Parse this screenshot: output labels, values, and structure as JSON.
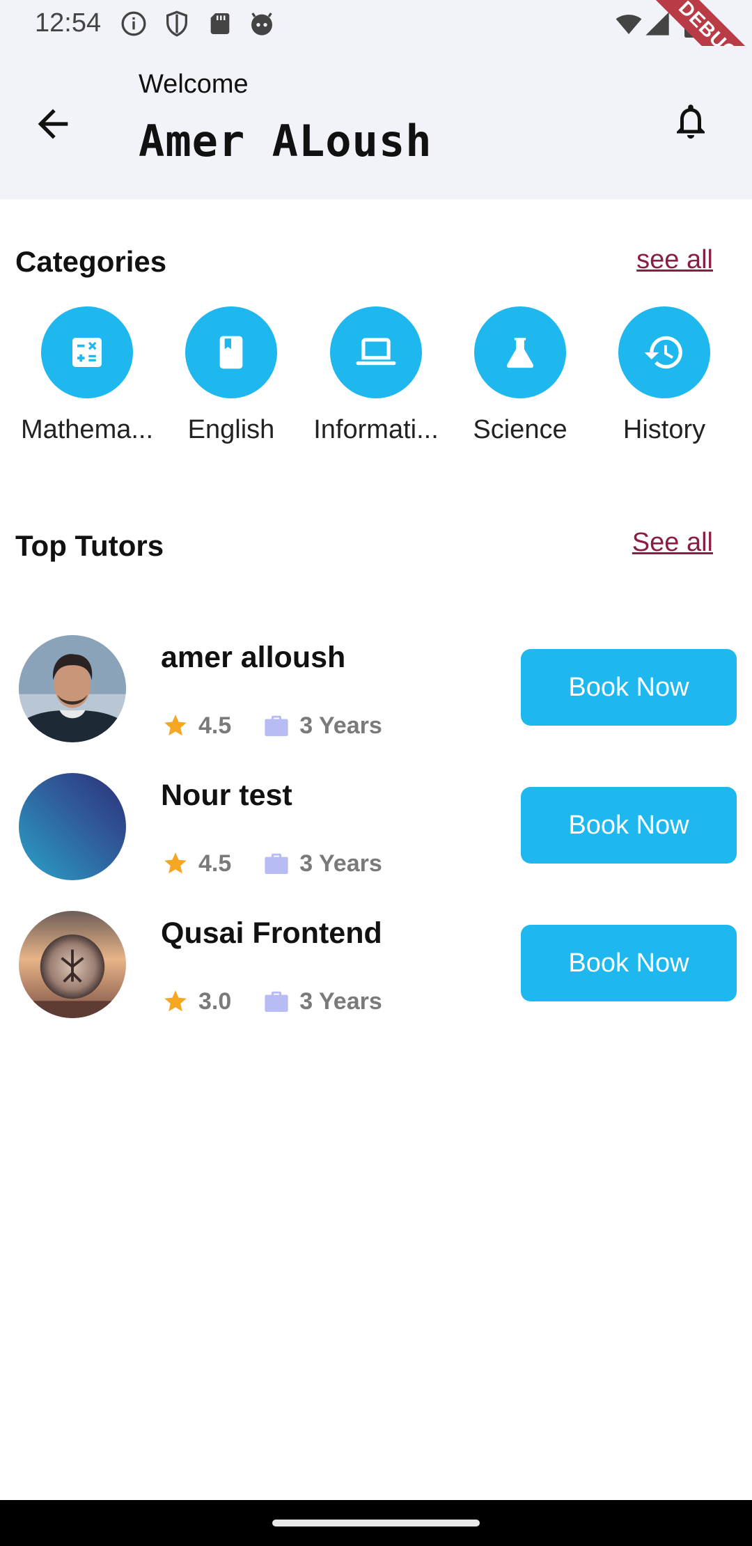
{
  "status_bar": {
    "time": "12:54",
    "icons": [
      "info-icon",
      "shield-icon",
      "sd-card-icon",
      "face-icon"
    ],
    "right_icons": [
      "wifi-icon",
      "signal-icon",
      "battery-icon"
    ],
    "debug_banner": "DEBUG"
  },
  "header": {
    "welcome": "Welcome",
    "user_name": "Amer ALoush",
    "back_icon": "arrow-back-icon",
    "notification_icon": "bell-icon"
  },
  "categories": {
    "title": "Categories",
    "see_all": "see all",
    "items": [
      {
        "label": "Mathema...",
        "icon": "calculator-icon"
      },
      {
        "label": "English",
        "icon": "book-icon"
      },
      {
        "label": "Informati...",
        "icon": "laptop-icon"
      },
      {
        "label": "Science",
        "icon": "flask-icon"
      },
      {
        "label": "History",
        "icon": "history-icon"
      }
    ]
  },
  "tutors": {
    "title": "Top Tutors",
    "see_all": "See all",
    "items": [
      {
        "name": "amer alloush",
        "rating": "4.5",
        "experience": "3 Years",
        "button": "Book Now"
      },
      {
        "name": "Nour test",
        "rating": "4.5",
        "experience": "3 Years",
        "button": "Book Now"
      },
      {
        "name": "Qusai Frontend",
        "rating": "3.0",
        "experience": "3 Years",
        "button": "Book Now"
      }
    ]
  },
  "colors": {
    "accent": "#1eb8ee",
    "link": "#8a1d44",
    "star": "#f5a623",
    "briefcase": "#b8bcf5",
    "header_bg": "#f2f2f9"
  }
}
